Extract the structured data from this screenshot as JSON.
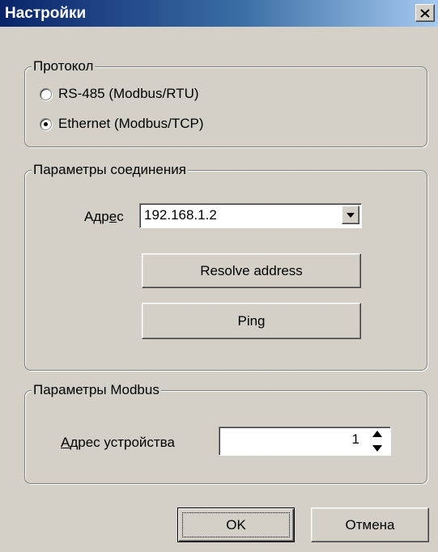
{
  "window": {
    "title": "Настройки",
    "close_glyph": "×"
  },
  "protocol": {
    "legend": "Протокол",
    "options": [
      {
        "label": "RS-485 (Modbus/RTU)",
        "checked": false
      },
      {
        "label": "Ethernet (Modbus/TCP)",
        "checked": true
      }
    ]
  },
  "connection": {
    "legend": "Параметры соединения",
    "address_label_pre": "Адр",
    "address_label_mnemonic": "е",
    "address_label_post": "с",
    "address_value": "192.168.1.2",
    "resolve_label": "Resolve address",
    "ping_label": "Ping"
  },
  "modbus": {
    "legend": "Параметры  Modbus",
    "device_label_mnemonic": "А",
    "device_label_post": "дрес устройства",
    "device_value": "1"
  },
  "footer": {
    "ok_label": "OK",
    "cancel_label": "Отмена"
  },
  "colors": {
    "face": "#d4d0c8",
    "title_start": "#0a246a",
    "title_end": "#a6caf0"
  },
  "icons": {
    "close": "close-icon",
    "combo_arrow": "chevron-down-icon",
    "spin": "spin-up-down-icon"
  }
}
